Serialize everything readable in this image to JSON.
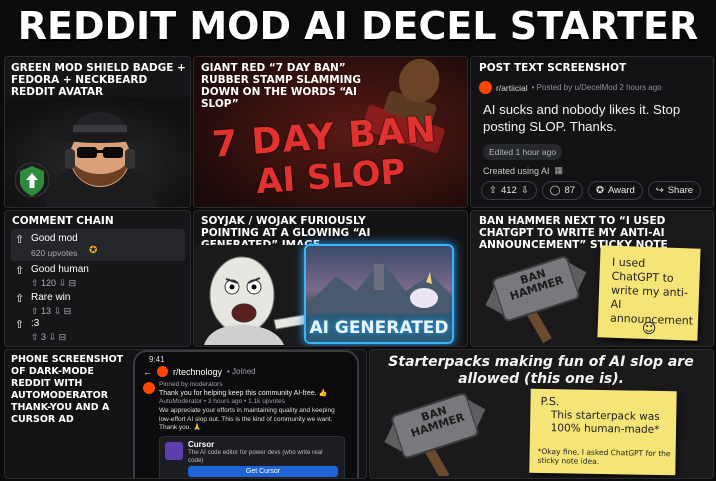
{
  "title": "REDDIT MOD AI DECEL STARTER PACK",
  "colors": {
    "accent_red": "#d8262b",
    "reddit_orange": "#ff4500",
    "mod_green": "#2e8b3e",
    "cursor_blue": "#1e64d6",
    "note_yellow": "#f5e476"
  },
  "panel1": {
    "caption": "GREEN MOD SHIELD BADGE + FEDORA + NECKBEARD REDDIT AVATAR"
  },
  "panel2": {
    "caption": "GIANT RED “7 DAY BAN” RUBBER STAMP SLAMMING DOWN ON THE WORDS “AI SLOP”",
    "stamp_line1": "7 DAY BAN",
    "stamp_line2": "AI SLOP"
  },
  "panel3": {
    "caption": "POST TEXT SCREENSHOT",
    "subreddit": "r/artiicial",
    "meta": "• Posted by u/DecelMod 2 hours ago",
    "body": "AI sucks and nobody likes it. Stop posting SLOP. Thanks.",
    "edited": "Edited 1 hour ago",
    "created_using": "Created using AI",
    "votes": "412",
    "comments": "87",
    "award": "Award",
    "share": "Share"
  },
  "panel4": {
    "caption": "COMMENT CHAIN",
    "comments": [
      {
        "text": "Good mod",
        "meta": "620 upvotes"
      },
      {
        "text": "Good human",
        "meta": "120"
      },
      {
        "text": "Rare win",
        "meta": "13"
      },
      {
        "text": ":3",
        "meta": "3"
      }
    ]
  },
  "panel5": {
    "caption": "SOYJAK / WOJAK FURIOUSLY POINTING AT A GLOWING “AI GENERATED” IMAGE",
    "label": "AI GENERATED"
  },
  "panel6": {
    "caption": "BAN HAMMER NEXT TO “I USED CHATGPT TO WRITE MY ANTI-AI ANNOUNCEMENT” STICKY NOTE",
    "hammer": "BAN HAMMER",
    "note": "I used ChatGPT to write my anti-AI announcement",
    "smile": "☺"
  },
  "panel7": {
    "caption": "PHONE SCREENSHOT OF DARK-MODE REDDIT WITH AUTOMODERATOR THANK-YOU AND A CURSOR AD",
    "time": "9:41",
    "sub": "r/technology",
    "joined": "• Joined",
    "pinned": "Pinned by moderators",
    "post_title": "Thank you for helping keep this community AI-free. 👍",
    "post_meta": "AutoModerator • 3 hours ago • 1.1k upvotes",
    "post_body": "We appreciate your efforts in maintaining quality and keeping low-effort AI slop out. This is the kind of community we want. Thank you. 🙏",
    "ad_title": "Cursor",
    "ad_text": "The AI code editor for power devs (who write real code)",
    "ad_button": "Get Cursor"
  },
  "panel8": {
    "heading": "Starterpacks making fun of AI slop are allowed (this one is).",
    "hammer": "BAN HAMMER",
    "note_ps": "P.S.",
    "note_body": "This starterpack was 100% human-made*",
    "note_fine": "*Okay fine, I asked ChatGPT for the sticky note idea."
  }
}
